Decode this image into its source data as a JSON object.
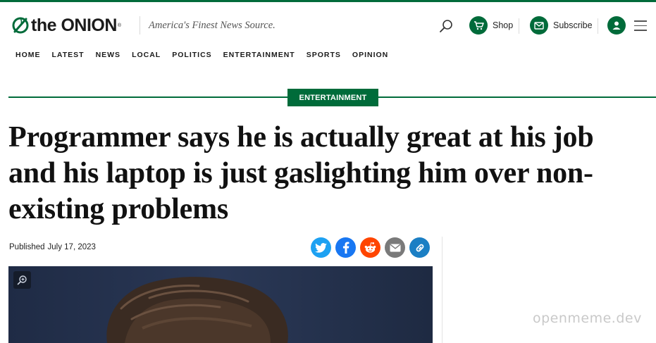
{
  "brand": {
    "name": "the ONION",
    "registered": "®",
    "tagline": "America's Finest News Source."
  },
  "header": {
    "shop_label": "Shop",
    "subscribe_label": "Subscribe"
  },
  "nav": {
    "items": [
      "HOME",
      "LATEST",
      "NEWS",
      "LOCAL",
      "POLITICS",
      "ENTERTAINMENT",
      "SPORTS",
      "OPINION"
    ]
  },
  "article": {
    "section": "ENTERTAINMENT",
    "headline": "Programmer says he is actually great at his job and his laptop is just gaslighting him over non-existing problems",
    "published_label": "Published",
    "published_date": "July 17, 2023"
  },
  "share": [
    {
      "icon": "twitter-icon",
      "color": "#1da1f2"
    },
    {
      "icon": "facebook-icon",
      "color": "#1877f2"
    },
    {
      "icon": "reddit-icon",
      "color": "#ff4500"
    },
    {
      "icon": "email-icon",
      "color": "#7a7a7a"
    },
    {
      "icon": "link-icon",
      "color": "#1b7fc4"
    }
  ],
  "colors": {
    "brand_green": "#006b3a",
    "text": "#111111"
  },
  "watermark": "openmeme.dev"
}
